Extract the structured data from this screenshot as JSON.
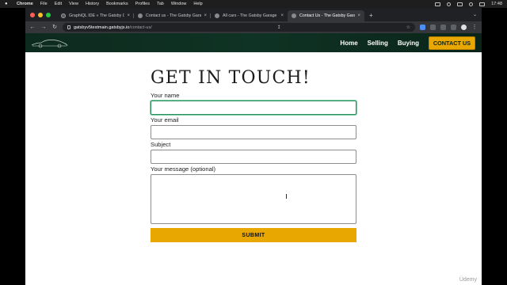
{
  "menubar": {
    "app": "Chrome",
    "items": [
      "File",
      "Edit",
      "View",
      "History",
      "Bookmarks",
      "Profiles",
      "Tab",
      "Window",
      "Help"
    ],
    "time": "17:48"
  },
  "tabs": [
    {
      "title": "GraphiQL IDE « The Gatsby Ga…",
      "active": false
    },
    {
      "title": "Contact us - The Gatsby Garage",
      "active": false
    },
    {
      "title": "All cars - The Gatsby Garage",
      "active": false
    },
    {
      "title": "Contact Us - The Gatsby Garag…",
      "active": true
    }
  ],
  "address": {
    "host": "gatsbyv5testmain.gatsbyjs.io",
    "path": "/contact-us/"
  },
  "site": {
    "nav": [
      "Home",
      "Selling",
      "Buying"
    ],
    "cta": "CONTACT US"
  },
  "form": {
    "heading": "GET IN TOUCH!",
    "name_label": "Your name",
    "email_label": "Your email",
    "subject_label": "Subject",
    "message_label": "Your message (optional)",
    "submit_label": "SUBMIT"
  },
  "watermark": "Üdemy",
  "colors": {
    "header_bg": "#0f3324",
    "accent": "#e8a701",
    "focus_border": "#2c8c5c"
  }
}
